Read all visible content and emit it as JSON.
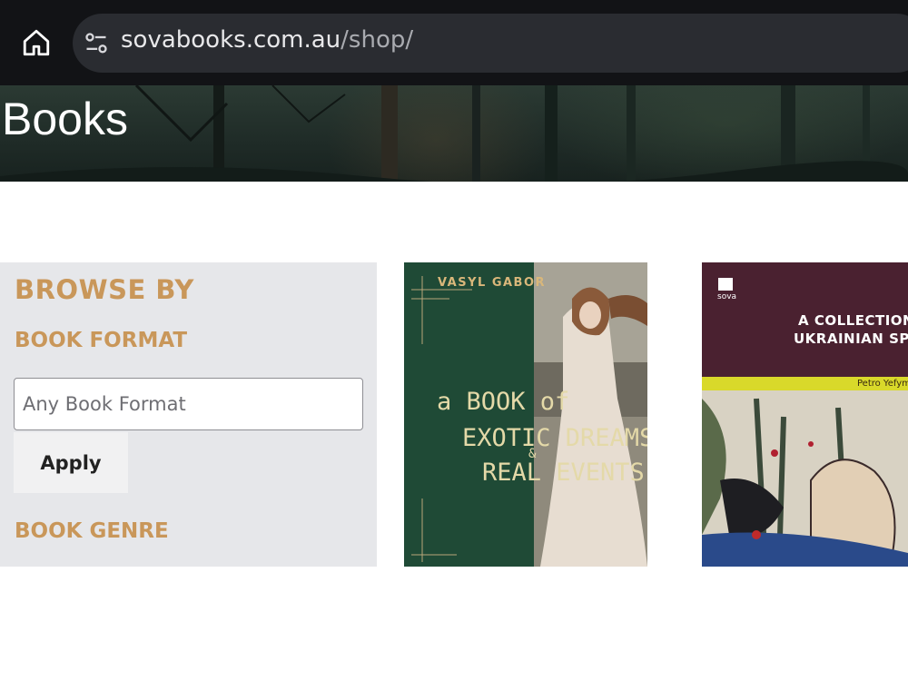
{
  "browser": {
    "home_icon": "home-icon",
    "site_info_icon": "tune-icon",
    "url_host": "sovabooks.com.au",
    "url_path": "/shop/"
  },
  "hero": {
    "title": "Books"
  },
  "sidebar": {
    "heading": "BROWSE BY",
    "format_label": "BOOK FORMAT",
    "format_value": "Any Book Format",
    "apply_label": "Apply",
    "genre_label": "BOOK GENRE"
  },
  "books": [
    {
      "author": "VASYL GABOR",
      "title_lines": [
        "a BOOK of",
        "EXOTIC DREAMS",
        "&",
        "REAL EVENTS"
      ]
    },
    {
      "publisher": "sova",
      "title_lines": [
        "A COLLECTION OF",
        "UKRAINIAN SPELL"
      ],
      "author": "Petro Yefyme"
    }
  ],
  "colors": {
    "chrome": "#121316",
    "accent": "#c9975a",
    "sidebar_bg": "#e6e7ea"
  }
}
